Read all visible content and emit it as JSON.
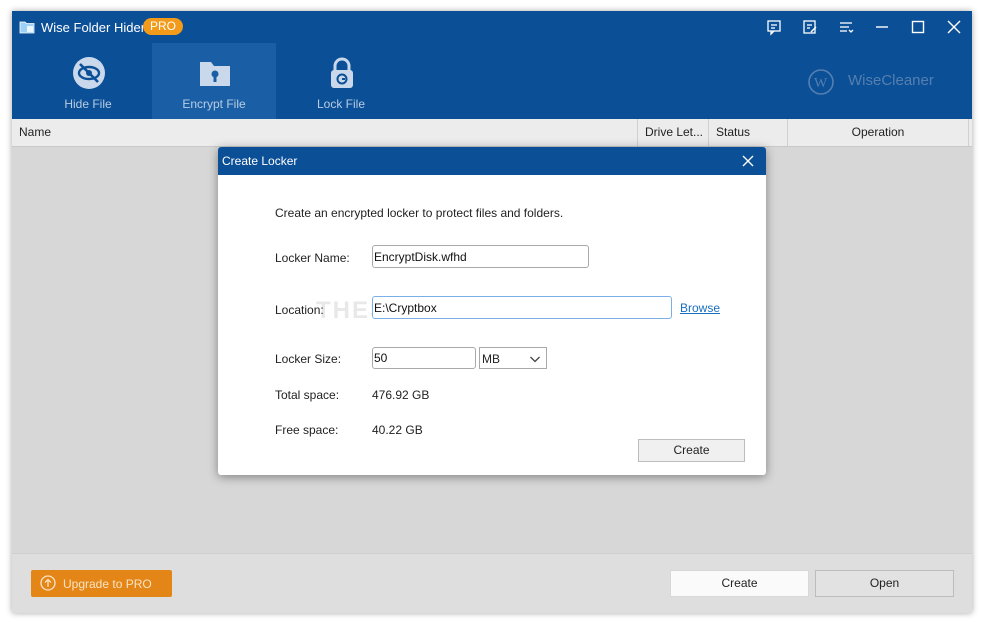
{
  "app": {
    "title": "Wise Folder Hider",
    "badge": "PRO",
    "accent": "#0b4f97",
    "badge_color": "#f29a1a"
  },
  "titlebar_icons": [
    "feedback-icon",
    "notes-icon",
    "menu-icon",
    "minimize-icon",
    "maximize-icon",
    "close-icon"
  ],
  "toolbar": {
    "tabs": [
      {
        "label": "Hide File",
        "icon": "eye-slash-icon"
      },
      {
        "label": "Encrypt File",
        "icon": "folder-key-icon"
      },
      {
        "label": "Lock File",
        "icon": "lock-icon"
      }
    ],
    "active": "Encrypt File",
    "brand": "WiseCleaner"
  },
  "list": {
    "columns": [
      "Name",
      "Drive Let...",
      "Status",
      "Operation"
    ]
  },
  "footer": {
    "upgrade_label": "Upgrade to PRO",
    "upgrade_color": "#e38617",
    "create_label": "Create",
    "open_label": "Open"
  },
  "dialog": {
    "title": "Create Locker",
    "intro": "Create an encrypted locker to protect files and folders.",
    "locker_name_label": "Locker Name:",
    "locker_name_value": "EncryptDisk.wfhd",
    "location_label": "Location:",
    "location_value": "E:\\Cryptbox",
    "browse_label": "Browse",
    "size_label": "Locker Size:",
    "size_value": "50",
    "size_unit": "MB",
    "total_label": "Total space:",
    "total_value": "476.92 GB",
    "free_label": "Free space:",
    "free_value": "40.22 GB",
    "create_label": "Create"
  },
  "watermark": "THESOFTWARE.SHOP"
}
